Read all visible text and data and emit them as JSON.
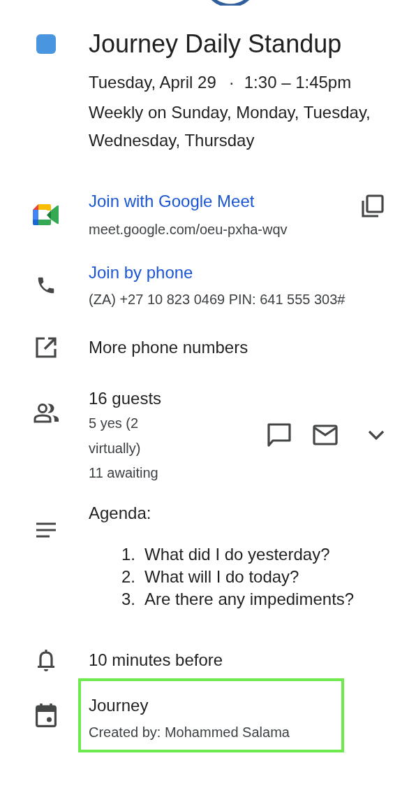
{
  "event": {
    "title": "Journey Daily Standup",
    "color": "#4a95e0",
    "date": "Tuesday, April 29",
    "separator": "·",
    "time": "1:30 – 1:45pm",
    "recurrence": "Weekly on Sunday, Monday, Tuesday, Wednesday, Thursday"
  },
  "meet": {
    "link": "Join with Google Meet",
    "url": "meet.google.com/oeu-pxha-wqv"
  },
  "phone": {
    "link": "Join by phone",
    "number": "(ZA) +27 10 823 0469 PIN: 641 555 303#"
  },
  "more_phone_numbers": "More phone numbers",
  "guests": {
    "title": "16 guests",
    "yes": "5 yes (2 virtually)",
    "awaiting": "11 awaiting",
    "expanded": false
  },
  "agenda": {
    "heading": "Agenda:",
    "items": [
      {
        "number": "1.",
        "text": "What did I do yesterday?"
      },
      {
        "number": "2.",
        "text": "What will I do today?"
      },
      {
        "number": "3.",
        "text": "Are there any impediments?"
      }
    ]
  },
  "reminder": "10 minutes before",
  "calendar": {
    "name": "Journey",
    "creator": "Created by: Mohammed Salama",
    "highlighted": true
  }
}
